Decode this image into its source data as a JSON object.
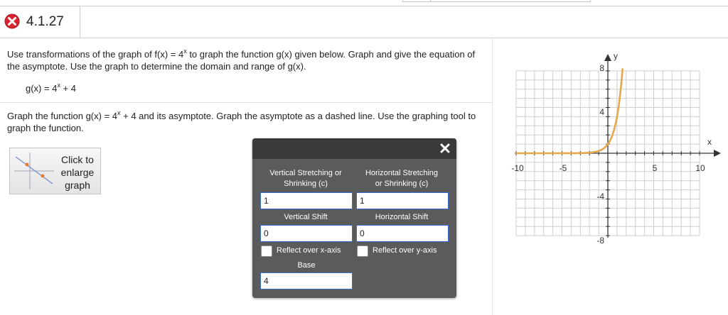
{
  "header": {
    "question_number": "4.1.27",
    "status_icon": "incorrect-x-icon"
  },
  "question": {
    "instructions": "Use transformations of the graph of f(x) = 4",
    "instructions_exp": "x",
    "instructions_rest": " to graph the function g(x) given below. Graph and give the equation of the asymptote. Use the graph to determine the domain and range of g(x).",
    "function_prefix": "g(x) = 4",
    "function_exp": "x",
    "function_suffix": " + 4",
    "graph_instruction_prefix": "Graph the function g(x) = 4",
    "graph_instruction_exp": "x",
    "graph_instruction_rest": " + 4 and its asymptote. Graph the asymptote as a dashed  line. Use the graphing tool to graph the function."
  },
  "enlarge_button": {
    "line1": "Click to",
    "line2": "enlarge",
    "line3": "graph"
  },
  "graphing_tool": {
    "vertical_stretch_label_1": "Vertical Stretching or",
    "vertical_stretch_label_2": "Shrinking (c)",
    "vertical_stretch_value": "1",
    "horizontal_stretch_label_1": "Horizontal Stretching",
    "horizontal_stretch_label_2": "or Shrinking (c)",
    "horizontal_stretch_value": "1",
    "vertical_shift_label": "Vertical Shift",
    "vertical_shift_value": "0",
    "horizontal_shift_label": "Horizontal Shift",
    "horizontal_shift_value": "0",
    "reflect_x_label": "Reflect over x-axis",
    "reflect_y_label": "Reflect over y-axis",
    "reflect_x_checked": false,
    "reflect_y_checked": false,
    "base_label": "Base",
    "base_value": "4"
  },
  "graph": {
    "x_axis_label": "x",
    "y_axis_label": "y",
    "x_ticks": [
      "-10",
      "-5",
      "5",
      "10"
    ],
    "y_ticks": [
      "8",
      "4",
      "-4",
      "-8"
    ],
    "curve_color": "#e6a84a",
    "curve_function": "4^x"
  }
}
